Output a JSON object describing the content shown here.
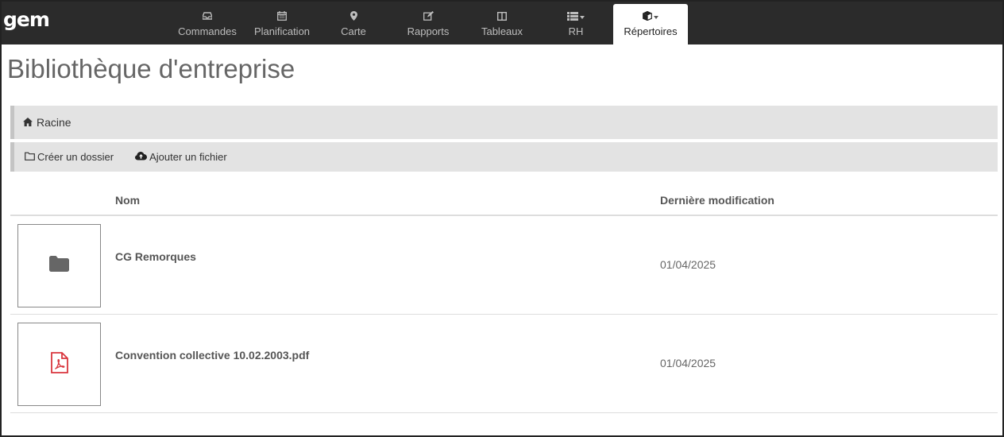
{
  "app": {
    "logo": "gem"
  },
  "nav": {
    "items": [
      {
        "label": "Commandes",
        "icon": "inbox-icon"
      },
      {
        "label": "Planification",
        "icon": "calendar-icon"
      },
      {
        "label": "Carte",
        "icon": "map-marker-icon"
      },
      {
        "label": "Rapports",
        "icon": "edit-icon"
      },
      {
        "label": "Tableaux",
        "icon": "columns-icon"
      },
      {
        "label": "RH",
        "icon": "list-icon"
      },
      {
        "label": "Répertoires",
        "icon": "cube-icon",
        "active": true
      }
    ]
  },
  "page": {
    "title": "Bibliothèque d'entreprise"
  },
  "breadcrumb": {
    "root": "Racine",
    "icon": "home-icon"
  },
  "toolbar": {
    "create_folder": "Créer un dossier",
    "add_file": "Ajouter un fichier"
  },
  "table": {
    "columns": {
      "name": "Nom",
      "modified": "Dernière modification"
    },
    "rows": [
      {
        "name": "CG Remorques",
        "modified": "01/04/2025",
        "type": "folder",
        "icon": "folder-icon"
      },
      {
        "name": "Convention collective 10.02.2003.pdf",
        "modified": "01/04/2025",
        "type": "pdf",
        "icon": "pdf-icon"
      }
    ]
  },
  "colors": {
    "navbar": "#2b2b2b",
    "nav_text": "#bdbdbd",
    "bar_bg": "#e3e3e3",
    "pdf_red": "#d9363e",
    "folder_gray": "#666666"
  }
}
